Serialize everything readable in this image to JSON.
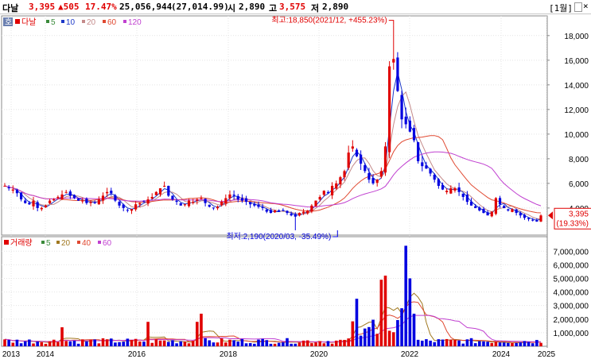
{
  "header": {
    "name": "다날",
    "price": "3,395",
    "change": "▲505",
    "change_pct": "17.47%",
    "volume": "25,056,944",
    "volume_pct": "(27,014.99)",
    "open_label": "시",
    "open": "2,890",
    "high_label": "고",
    "high": "3,575",
    "low_label": "저",
    "low": "2,890",
    "period": "[1월]"
  },
  "colors": {
    "up": "#e00000",
    "down": "#0000e0",
    "ma5": "#3a8a3a",
    "ma10": "#1c38c8",
    "ma20": "#c48a8a",
    "ma60": "#e04830",
    "ma120": "#c040d0",
    "vma40": "#e04830",
    "vma60": "#c040d0",
    "vma5": "#a07820"
  },
  "chart_data": [
    {
      "type": "candlestick",
      "title": "다날",
      "series_legend": [
        {
          "name": "다날",
          "icon": "square"
        },
        {
          "name": "5"
        },
        {
          "name": "10"
        },
        {
          "name": "20"
        },
        {
          "name": "60"
        },
        {
          "name": "120"
        }
      ],
      "mode_badge": "호",
      "x": [
        "2013",
        "2014",
        "2016",
        "2018",
        "2020",
        "2022",
        "2024",
        "2025"
      ],
      "ylim": [
        1800,
        19600
      ],
      "yticks": [
        4000,
        6000,
        8000,
        10000,
        12000,
        14000,
        16000,
        18000
      ],
      "ytick_labels": [
        "4,000",
        "6,000",
        "8,000",
        "10,000",
        "12,000",
        "14,000",
        "16,000",
        "18,000"
      ],
      "close_path": [
        5800,
        5600,
        5500,
        5200,
        4700,
        4400,
        4300,
        4600,
        4000,
        4000,
        4200,
        4600,
        4700,
        4900,
        5100,
        5300,
        5000,
        4800,
        4600,
        4600,
        4400,
        4500,
        4400,
        4700,
        5000,
        5300,
        5200,
        4600,
        4200,
        4000,
        3800,
        3900,
        4300,
        4400,
        4500,
        4700,
        4900,
        5300,
        5600,
        5800,
        5000,
        4700,
        4500,
        4200,
        4300,
        4600,
        4500,
        4700,
        4800,
        4400,
        4100,
        4000,
        4100,
        4500,
        4800,
        5100,
        5000,
        4700,
        4600,
        4500,
        4300,
        4200,
        4100,
        4000,
        3700,
        3600,
        3800,
        3700,
        3800,
        3600,
        3400,
        3300,
        3600,
        3700,
        3800,
        4200,
        4600,
        4900,
        5400,
        5200,
        5800,
        6000,
        6500,
        7000,
        8500,
        9000,
        8200,
        7600,
        7000,
        6300,
        6000,
        6300,
        7000,
        9000,
        15500,
        16100,
        13500,
        11200,
        10800,
        10200,
        9500,
        7800,
        7400,
        7200,
        6800,
        6300,
        5800,
        5500,
        5400,
        5600,
        5600,
        5300,
        4900,
        4500,
        4200,
        4000,
        3800,
        3600,
        3400,
        3700,
        4800,
        4300,
        4000,
        3800,
        3900,
        3600,
        3400,
        3200,
        3100,
        3000,
        2900,
        3395
      ],
      "annotations": [
        {
          "label": "최고:18,850(2021/12, +455.23%)",
          "value": 18850
        },
        {
          "label": "최저:2,190(2020/03, -35.49%)",
          "value": 2190
        }
      ],
      "last_price_box": {
        "price": "3,395",
        "pct": "(19.33%)"
      }
    },
    {
      "type": "bar",
      "title": "거래량",
      "series_legend": [
        {
          "name": "거래량",
          "icon": "square"
        },
        {
          "name": "5"
        },
        {
          "name": "20"
        },
        {
          "name": "40"
        },
        {
          "name": "60"
        }
      ],
      "ylim": [
        0,
        7600000
      ],
      "yticks": [
        1000000,
        2000000,
        3000000,
        4000000,
        5000000,
        6000000,
        7000000
      ],
      "ytick_labels": [
        "1,000,000",
        "2,000,000",
        "3,000,000",
        "4,000,000",
        "5,000,000",
        "6,000,000",
        "7,000,000"
      ],
      "peak_volumes": [
        {
          "year": "2016",
          "value": 2400000
        },
        {
          "year": "2020",
          "value": 3500000
        },
        {
          "year": "2021",
          "value": 5200000
        },
        {
          "year": "2021",
          "value": 7400000
        },
        {
          "year": "2022",
          "value": 5000000
        }
      ]
    }
  ]
}
